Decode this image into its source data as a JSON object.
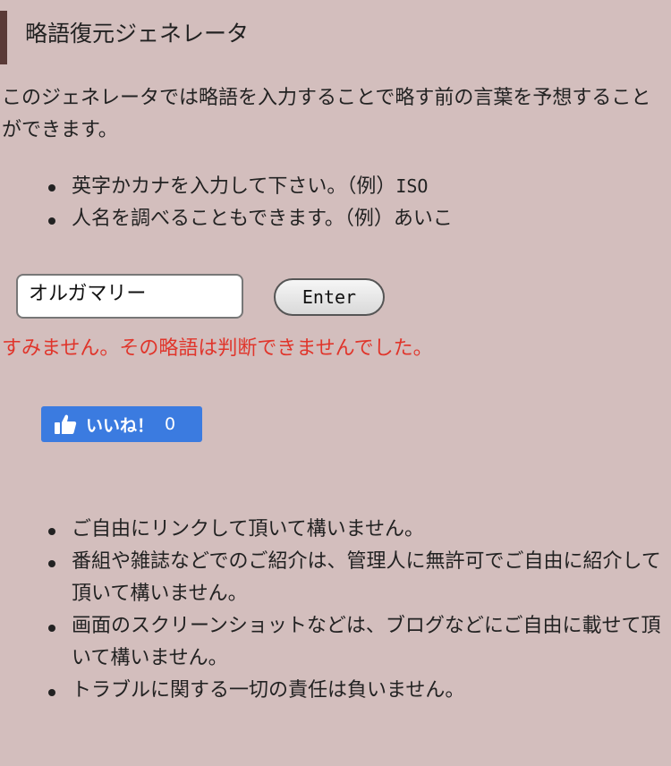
{
  "header": {
    "title": "略語復元ジェネレータ"
  },
  "intro": {
    "text": "このジェネレータでは略語を入力することで略す前の言葉を予想することができます。"
  },
  "examples": [
    {
      "text": "英字かカナを入力して下さい。（例）",
      "code": "ISO"
    },
    {
      "text": "人名を調べることもできます。（例）あいこ"
    }
  ],
  "form": {
    "input_value": "オルガマリー",
    "submit_label": "Enter"
  },
  "result": {
    "error": "すみません。その略語は判断できませんでした。"
  },
  "like": {
    "label": "いいね！",
    "count": "0",
    "icon": "thumbs-up-icon",
    "color": "#3b7be0"
  },
  "notes": [
    "ご自由にリンクして頂いて構いません。",
    "番組や雑誌などでのご紹介は、管理人に無許可でご自由に紹介して頂いて構いません。",
    "画面のスクリーンショットなどは、ブログなどにご自由に載せて頂いて構いません。",
    "トラブルに関する一切の責任は負いません。"
  ],
  "colors": {
    "background": "#d3bebd",
    "accent": "#5a3a37",
    "error": "#e0352b"
  }
}
